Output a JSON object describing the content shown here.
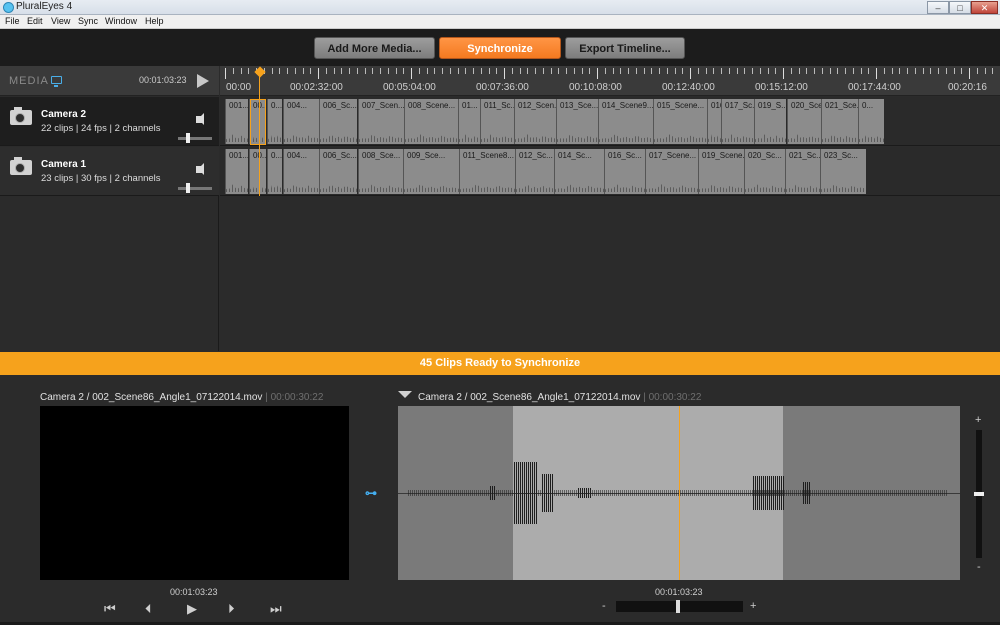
{
  "window": {
    "title": "PluralEyes 4",
    "controls": {
      "minimize": "–",
      "maximize": "□",
      "close": "✕"
    }
  },
  "menu": [
    "File",
    "Edit",
    "View",
    "Sync",
    "Window",
    "Help"
  ],
  "toolbar": {
    "add_media": "Add More Media...",
    "synchronize": "Synchronize",
    "export_timeline": "Export Timeline..."
  },
  "media_header": {
    "label": "MEDIA",
    "timecode": "00:01:03:23"
  },
  "ruler_labels": [
    "00:00",
    "00:02:32:00",
    "00:05:04:00",
    "00:07:36:00",
    "00:10:08:00",
    "00:12:40:00",
    "00:15:12:00",
    "00:17:44:00",
    "00:20:16"
  ],
  "tracks": [
    {
      "name": "Camera 2",
      "info": "22 clips  |  24 fps  |  2 channels",
      "clips": [
        "001...",
        "00...",
        "0...",
        "004...",
        "006_Sc...",
        "007_Scen...",
        "008_Scene...",
        "01...",
        "011_Sc...",
        "012_Scen...",
        "013_Sce...",
        "014_Scene9...",
        "015_Scene...",
        "016...",
        "017_Sc...",
        "019_S...",
        "020_Sce...",
        "021_Sce...",
        "0..."
      ]
    },
    {
      "name": "Camera 1",
      "info": "23 clips  |  30 fps  |  2 channels",
      "clips": [
        "001...",
        "00...",
        "0...",
        "004...",
        "006_Sc...",
        "008_Sce...",
        "009_Sce...",
        "011_Scene8...",
        "012_Sc...",
        "014_Sc...",
        "016_Sc...",
        "017_Scene...",
        "019_Scene...",
        "020_Sc...",
        "021_Sc...",
        "023_Sc..."
      ]
    }
  ],
  "status": "45 Clips Ready to Synchronize",
  "preview_left": {
    "title": "Camera 2 / 002_Scene86_Angle1_07122014.mov",
    "sep": "|",
    "duration": "00:00:30:22",
    "timecode": "00:01:03:23",
    "controls": {
      "start": "⏮",
      "back": "⏴",
      "play": "▶",
      "forward": "⏵",
      "end": "⏭"
    }
  },
  "preview_right": {
    "title": "Camera 2 / 002_Scene86_Angle1_07122014.mov",
    "sep": "|",
    "duration": "00:00:30:22",
    "timecode": "00:01:03:23",
    "zoom_minus": "-",
    "zoom_plus": "+",
    "vzoom_plus": "+",
    "vzoom_minus": "-"
  },
  "link_icon": "link-icon",
  "colors": {
    "accent": "#f6a21c",
    "sync_button": "#f47a20",
    "link": "#44aef0"
  }
}
